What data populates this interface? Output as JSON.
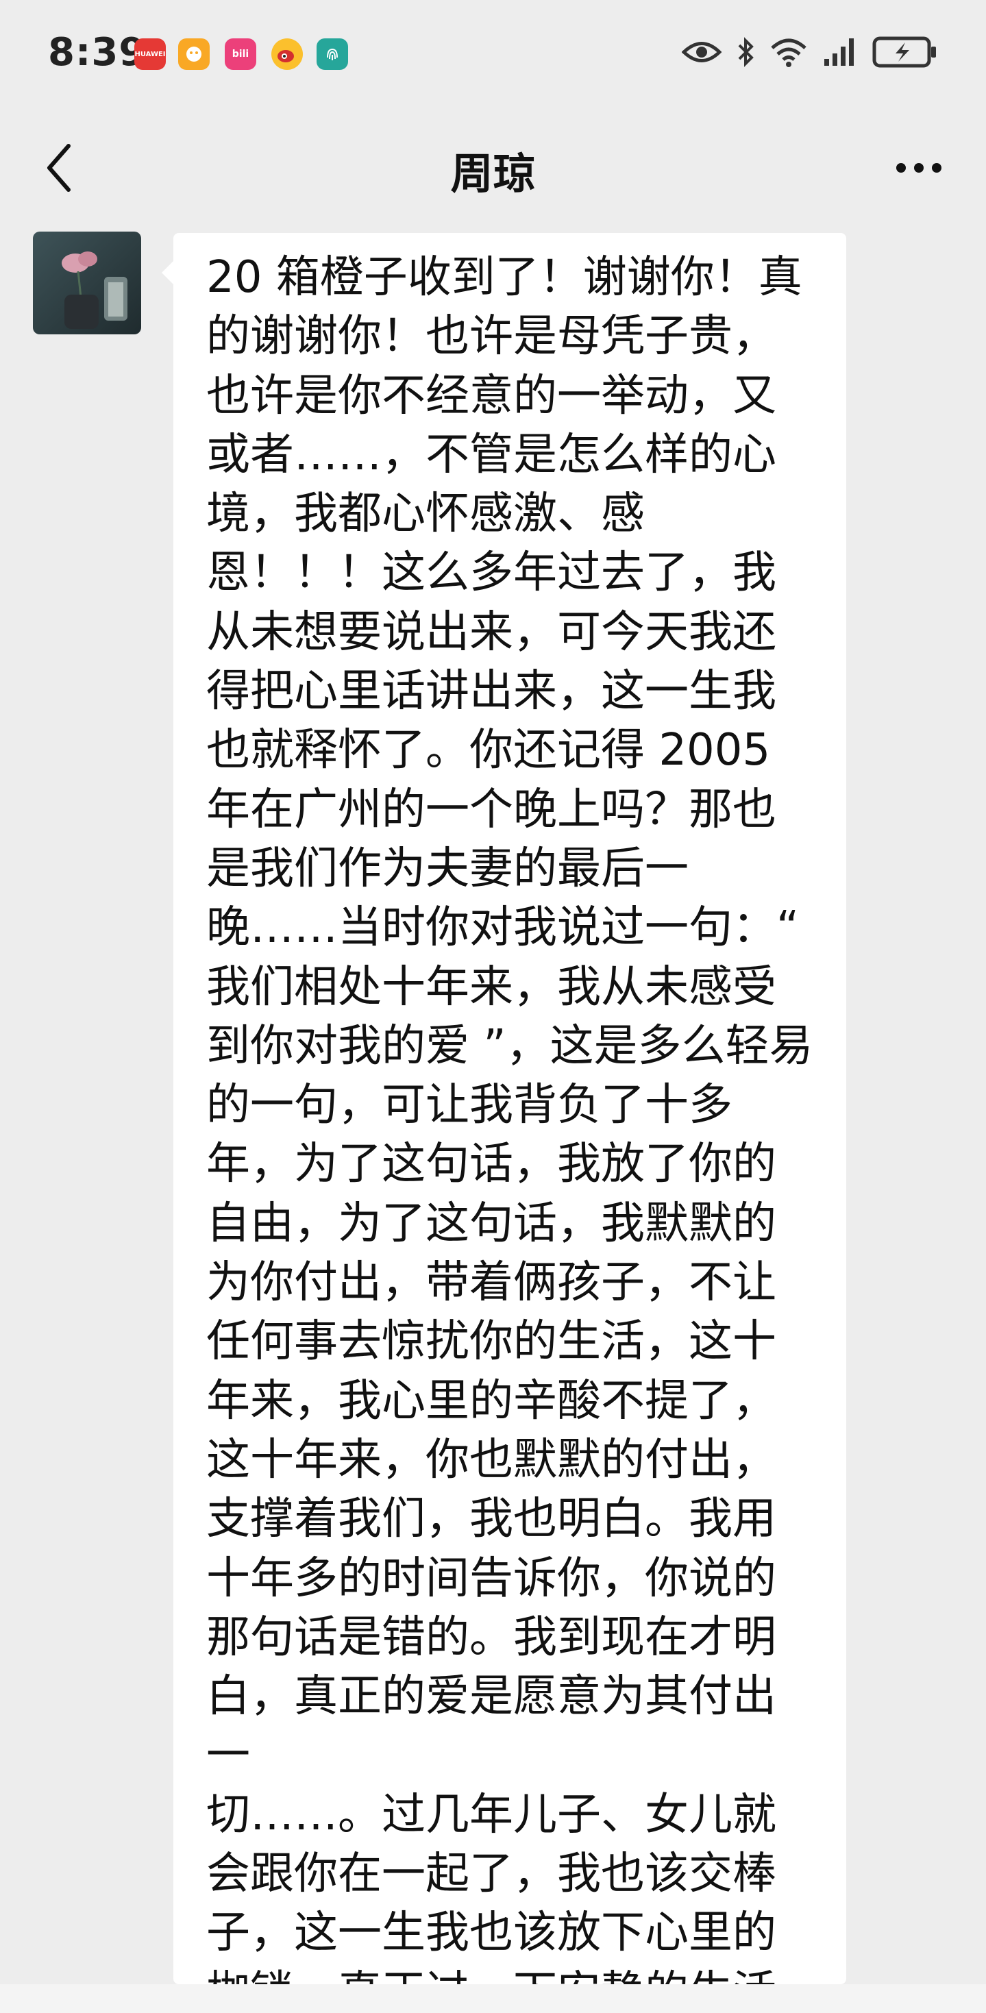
{
  "status_bar": {
    "time": "8:39",
    "app_icons": [
      {
        "icon": "huawei-app-icon",
        "color": "#e53935",
        "label": "HUAWEI"
      },
      {
        "icon": "game-center-icon",
        "color": "#f9a825",
        "label": ""
      },
      {
        "icon": "bilibili-icon",
        "color": "#ec407a",
        "label": "bili"
      },
      {
        "icon": "weibo-icon",
        "color": "#fbc02d",
        "label": ""
      },
      {
        "icon": "fingerprint-app-icon",
        "color": "#26a69a",
        "label": ""
      }
    ],
    "indicators": [
      "eye-icon",
      "bluetooth-icon",
      "wifi-icon",
      "signal-icon",
      "battery-charging-icon"
    ]
  },
  "header": {
    "title": "周琼",
    "back_icon": "chevron-left-icon",
    "more_icon": "more-dots-icon"
  },
  "message": {
    "text": "20 箱橙子收到了！谢谢你！真的谢谢你！也许是母凭子贵，也许是你不经意的一举动，又或者……，不管是怎么样的心境，我都心怀感激、感\n恩！！！这么多年过去了，我从未想要说出来，可今天我还得把心里话讲出来，这一生我也就释怀了。你还记得 2005 年在广州的一个晚上吗？那也是我们作为夫妻的最后一晚……当时你对我说过一句：“ 我们相处十年来，我从未感受到你对我的爱 ”，这是多么轻易的一句，可让我背负了十多年，为了这句话，我放了你的自由，为了这句话，我默默的为你付出，带着俩孩子，不让任何事去惊扰你的生活，这十年来，我心里的辛酸不提了，这十年来，你也默默的付出，支撑着我们，我也明白。我用十年多的时间告诉你，你说的那句话是错的。我到现在才明白，真正的爱是愿意为其付出一\n切……。过几年儿子、女儿就会跟你在一起了，我也该交棒子，这一生我也该放下心里的枷锁，真正过一下安静的生活"
  },
  "colors": {
    "background": "#ededed",
    "bubble": "#ffffff",
    "text": "#111111"
  }
}
